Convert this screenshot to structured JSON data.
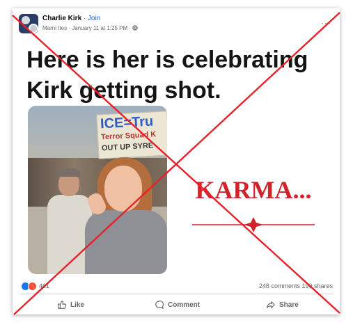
{
  "post": {
    "author": "Charlie Kirk",
    "separator": " · ",
    "join_label": "Join",
    "meta": "Marni Ites · January 11 at 1:25 PM ·",
    "more_label": "···"
  },
  "image": {
    "headline_line1": "Here is her is celebrating",
    "headline_line2": "Kirk getting shot.",
    "sign_line1": "ICE=Tru",
    "sign_line2": "Terror Squad K",
    "sign_line3": "OUT UP SYRE",
    "karma_text": "KARMA..."
  },
  "stats": {
    "reaction_count": "461",
    "comments": "248 comments",
    "shares": "190 shares"
  },
  "actions": {
    "like_label": "Like",
    "comment_label": "Comment",
    "share_label": "Share"
  },
  "colors": {
    "x_overlay": "#e8202a",
    "link_blue": "#0866ff",
    "karma_red": "#d1232a"
  },
  "icons": [
    "group-avatar-icon",
    "globe-icon",
    "more-options-icon",
    "like-reaction-icon",
    "angry-reaction-icon",
    "thumbs-up-icon",
    "comment-bubble-icon",
    "share-arrow-icon"
  ]
}
